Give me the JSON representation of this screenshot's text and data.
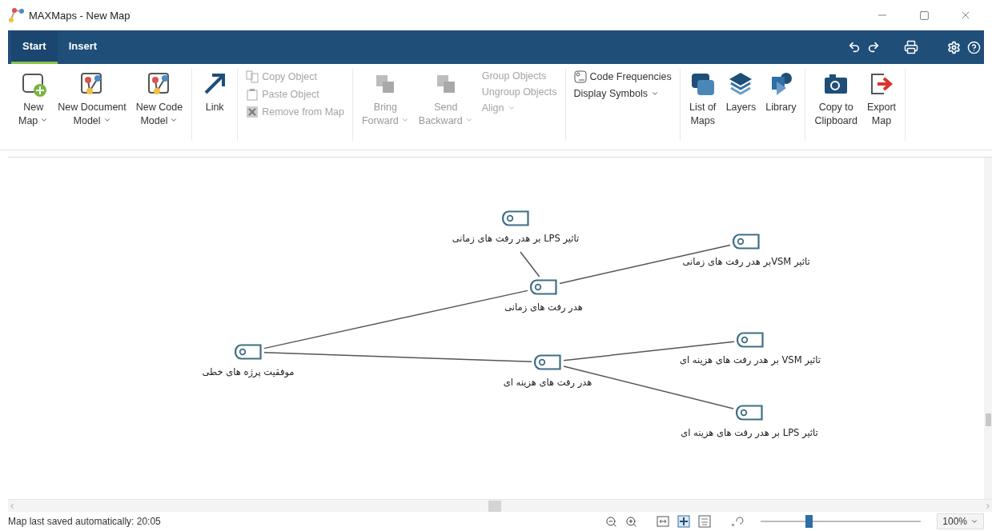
{
  "window": {
    "title": "MAXMaps - New Map"
  },
  "tabs": [
    {
      "label": "Start",
      "selected": true
    },
    {
      "label": "Insert",
      "selected": false
    }
  ],
  "ribbon": {
    "groups": [
      {
        "items": [
          {
            "kind": "large",
            "lines": [
              "New",
              "Map"
            ],
            "dropdown": true,
            "disabled": false
          },
          {
            "kind": "large",
            "lines": [
              "New Document",
              "Model"
            ],
            "dropdown": true,
            "disabled": false
          },
          {
            "kind": "large",
            "lines": [
              "New Code",
              "Model"
            ],
            "dropdown": true,
            "disabled": false
          }
        ]
      },
      {
        "items": [
          {
            "kind": "large",
            "lines": [
              "Link"
            ],
            "dropdown": false,
            "disabled": false
          }
        ]
      },
      {
        "items": [
          {
            "kind": "small",
            "lines": [
              "Copy Object"
            ],
            "dropdown": false,
            "disabled": true
          },
          {
            "kind": "small",
            "lines": [
              "Paste Object"
            ],
            "dropdown": false,
            "disabled": true
          },
          {
            "kind": "small",
            "lines": [
              "Remove from Map"
            ],
            "dropdown": false,
            "disabled": true
          }
        ]
      },
      {
        "items": [
          {
            "kind": "large",
            "lines": [
              "Bring",
              "Forward"
            ],
            "dropdown": true,
            "disabled": true
          },
          {
            "kind": "large",
            "lines": [
              "Send",
              "Backward"
            ],
            "dropdown": true,
            "disabled": true
          },
          {
            "kind": "small",
            "lines": [
              "Group Objects"
            ],
            "dropdown": false,
            "disabled": true
          },
          {
            "kind": "small",
            "lines": [
              "Ungroup Objects"
            ],
            "dropdown": false,
            "disabled": true
          },
          {
            "kind": "small",
            "lines": [
              "Align"
            ],
            "dropdown": true,
            "disabled": true
          }
        ]
      },
      {
        "items": [
          {
            "kind": "small",
            "lines": [
              "Code Frequencies"
            ],
            "dropdown": false,
            "disabled": false
          },
          {
            "kind": "small",
            "lines": [
              "Display Symbols"
            ],
            "dropdown": true,
            "disabled": false
          }
        ]
      },
      {
        "items": [
          {
            "kind": "large",
            "lines": [
              "List of",
              "Maps"
            ],
            "dropdown": false,
            "disabled": false
          },
          {
            "kind": "large",
            "lines": [
              "Layers"
            ],
            "dropdown": false,
            "disabled": false
          },
          {
            "kind": "large",
            "lines": [
              "Library"
            ],
            "dropdown": false,
            "disabled": false
          }
        ]
      },
      {
        "items": [
          {
            "kind": "large",
            "lines": [
              "Copy to",
              "Clipboard"
            ],
            "dropdown": false,
            "disabled": false
          },
          {
            "kind": "large",
            "lines": [
              "Export",
              "Map"
            ],
            "dropdown": false,
            "disabled": false
          }
        ]
      }
    ]
  },
  "map": {
    "root": {
      "label": "موفقیت پرژه های خطی",
      "children": [
        {
          "label": "هدر رفت های زمانی",
          "children": [
            {
              "label": "تاثیر LPS بر هدر رفت های زمانی"
            },
            {
              "label": "تاثیر VSMبر هدر رفت های  زمانی"
            }
          ]
        },
        {
          "label": "هدر رفت های هزینه ای",
          "children": [
            {
              "label": "تاثیر VSM بر هدر رفت های هزینه ای"
            },
            {
              "label": "تاثیر LPS بر هدر رفت های هزینه ای"
            }
          ]
        }
      ]
    }
  },
  "status_bar": {
    "text": "Map last saved automatically: 20:05",
    "zoom": {
      "level": 0.3,
      "value": "100%"
    }
  }
}
